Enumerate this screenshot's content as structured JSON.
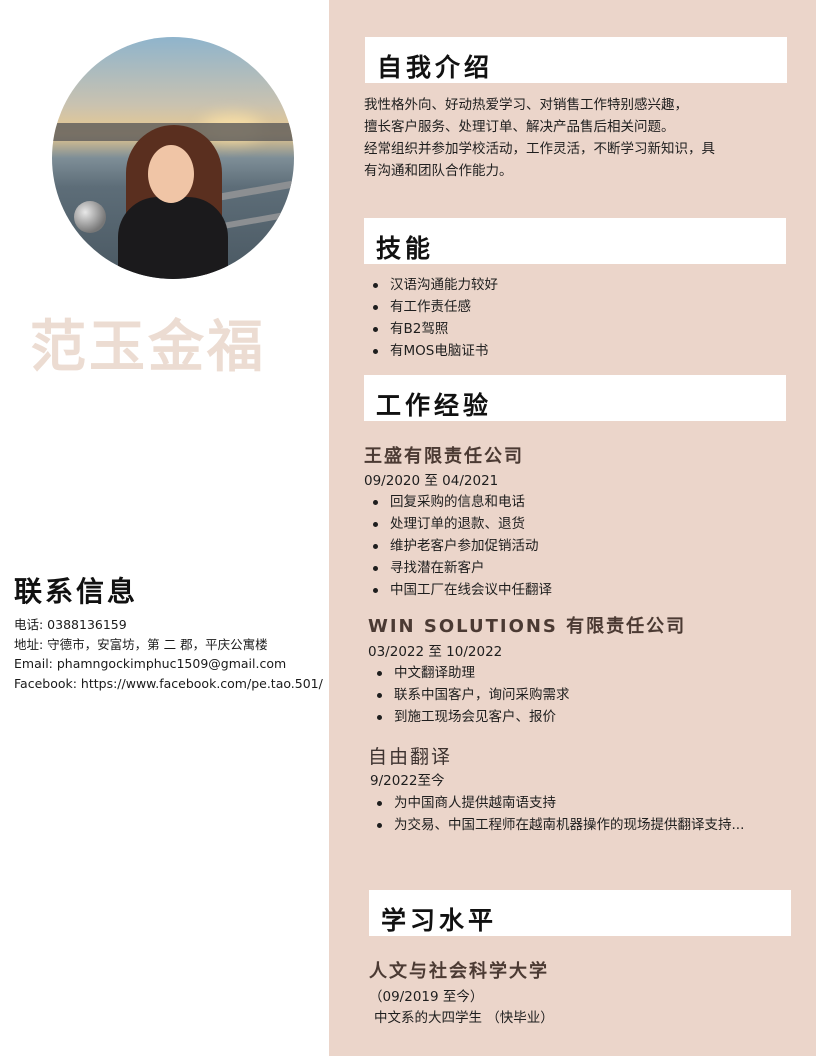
{
  "profile": {
    "name": "范玉金福",
    "contact_heading": "联系信息",
    "phone": "电话: 0388136159",
    "address": "地址: 守德市，安富坊，第 二 郡，平庆公寓楼",
    "email": "Email: phamngockimphuc1509@gmail.com",
    "facebook": "Facebook: https://www.facebook.com/pe.tao.501/"
  },
  "intro": {
    "heading": "自我介绍",
    "lines": [
      "我性格外向、好动热爱学习、对销售工作特别感兴趣，",
      "擅长客户服务、处理订单、解决产品售后相关问题。",
      " 经常组织并参加学校活动，工作灵活，不断学习新知识，具",
      "有沟通和团队合作能力。"
    ]
  },
  "skills": {
    "heading": "技能",
    "items": [
      "汉语沟通能力较好",
      "有工作责任感",
      "有B2驾照",
      "有MOS电脑证书"
    ]
  },
  "experience": {
    "heading": "工作经验",
    "jobs": [
      {
        "company": "王盛有限责任公司",
        "date": "09/2020 至 04/2021",
        "items": [
          "回复采购的信息和电话",
          "处理订单的退款、退货",
          "维护老客户参加促销活动",
          "寻找潜在新客户",
          "中国工厂在线会议中任翻译"
        ]
      },
      {
        "company": "WIN SOLUTIONS 有限责任公司",
        "date": "03/2022 至 10/2022",
        "items": [
          "中文翻译助理",
          "联系中国客户，询问采购需求",
          "到施工现场会见客户、报价"
        ]
      },
      {
        "company": "自由翻译",
        "date": "9/2022至今",
        "items": [
          "为中国商人提供越南语支持",
          " 为交易、中国工程师在越南机器操作的现场提供翻译支持..."
        ]
      }
    ]
  },
  "education": {
    "heading": "学习水平",
    "school": "人文与社会科学大学",
    "period": "（09/2019 至今）",
    "detail": "中文系的大四学生 （快毕业）"
  },
  "colors": {
    "panel": "#ebd5ca",
    "name": "#ecdcd2",
    "company": "#4b3a33"
  }
}
